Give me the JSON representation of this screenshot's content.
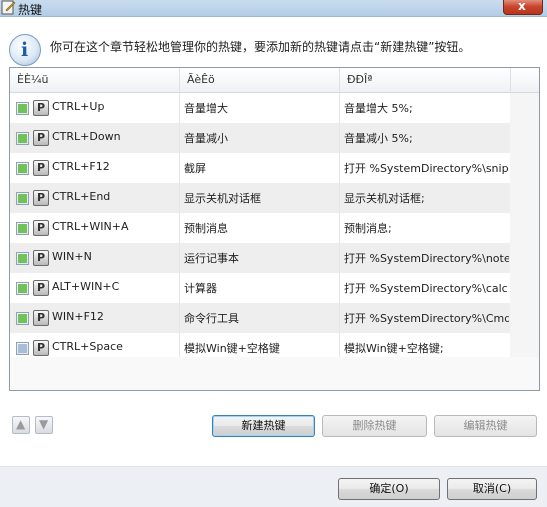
{
  "window": {
    "title": "热键",
    "close_label": "x"
  },
  "info": {
    "icon": "info-icon",
    "glyph": "i",
    "description": "你可在这个章节轻松地管理你的热键，要添加新的热键请点击“新建热键”按钮。"
  },
  "table": {
    "headers": [
      "ÈÈ¼ü",
      "ÃèÊö",
      "ÐÐÎª"
    ],
    "rows": [
      {
        "checked": true,
        "key": "CTRL+Up",
        "description": "音量增大",
        "action": "音量增大 5%;"
      },
      {
        "checked": true,
        "key": "CTRL+Down",
        "description": "音量减小",
        "action": "音量减小 5%;"
      },
      {
        "checked": true,
        "key": "CTRL+F12",
        "description": "截屏",
        "action": "打开 %SystemDirectory%\\snip..."
      },
      {
        "checked": true,
        "key": "CTRL+End",
        "description": "显示关机对话框",
        "action": "显示关机对话框;"
      },
      {
        "checked": true,
        "key": "CTRL+WIN+A",
        "description": "预制消息",
        "action": "预制消息;"
      },
      {
        "checked": true,
        "key": "WIN+N",
        "description": "运行记事本",
        "action": "打开 %SystemDirectory%\\note..."
      },
      {
        "checked": true,
        "key": "ALT+WIN+C",
        "description": "计算器",
        "action": "打开 %SystemDirectory%\\calc...."
      },
      {
        "checked": true,
        "key": "WIN+F12",
        "description": "命令行工具",
        "action": "打开 %SystemDirectory%\\Cmd...."
      },
      {
        "checked": false,
        "key": "CTRL+Space",
        "description": "模拟Win键+空格键",
        "action": "模拟Win键+空格键;"
      }
    ],
    "key_icon_letter": "P"
  },
  "actions": {
    "new": "新建热键",
    "delete": "删除热键",
    "edit": "编辑热键",
    "move_up_icon": "arrow-up-icon",
    "move_down_icon": "arrow-down-icon"
  },
  "footer": {
    "ok": "确定(O)",
    "cancel": "取消(C)"
  }
}
